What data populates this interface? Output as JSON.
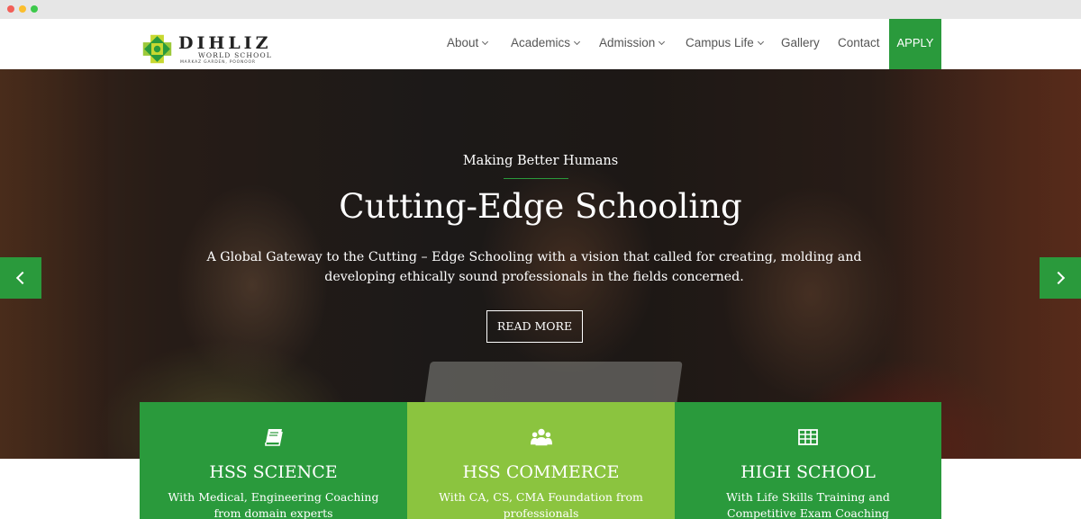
{
  "header": {
    "logo": {
      "name": "DIHLIZ",
      "subtitle": "WORLD SCHOOL",
      "tagline": "MARKAZ GARDEN, POONOOR"
    },
    "nav": [
      {
        "label": "About",
        "has_dropdown": true
      },
      {
        "label": "Academics",
        "has_dropdown": true
      },
      {
        "label": "Admission",
        "has_dropdown": true
      },
      {
        "label": "Campus Life",
        "has_dropdown": true
      },
      {
        "label": "Gallery",
        "has_dropdown": false
      },
      {
        "label": "Contact",
        "has_dropdown": false
      }
    ],
    "apply_label": "APPLY"
  },
  "hero": {
    "tagline": "Making Better Humans",
    "title": "Cutting-Edge Schooling",
    "description": "A Global Gateway to the Cutting – Edge Schooling with a vision that called for creating, molding and developing ethically sound professionals in the fields concerned.",
    "button_label": "READ MORE"
  },
  "cards": [
    {
      "icon": "book-icon",
      "title": "HSS SCIENCE",
      "text": "With Medical, Engineering Coaching from domain experts"
    },
    {
      "icon": "users-icon",
      "title": "HSS COMMERCE",
      "text": "With CA, CS, CMA Foundation from professionals"
    },
    {
      "icon": "table-icon",
      "title": "HIGH SCHOOL",
      "text": "With Life Skills Training and Competitive Exam Coaching"
    }
  ],
  "colors": {
    "primary_green": "#2a9a3c",
    "light_green": "#8bc43f",
    "logo_yellow": "#c8d830"
  }
}
